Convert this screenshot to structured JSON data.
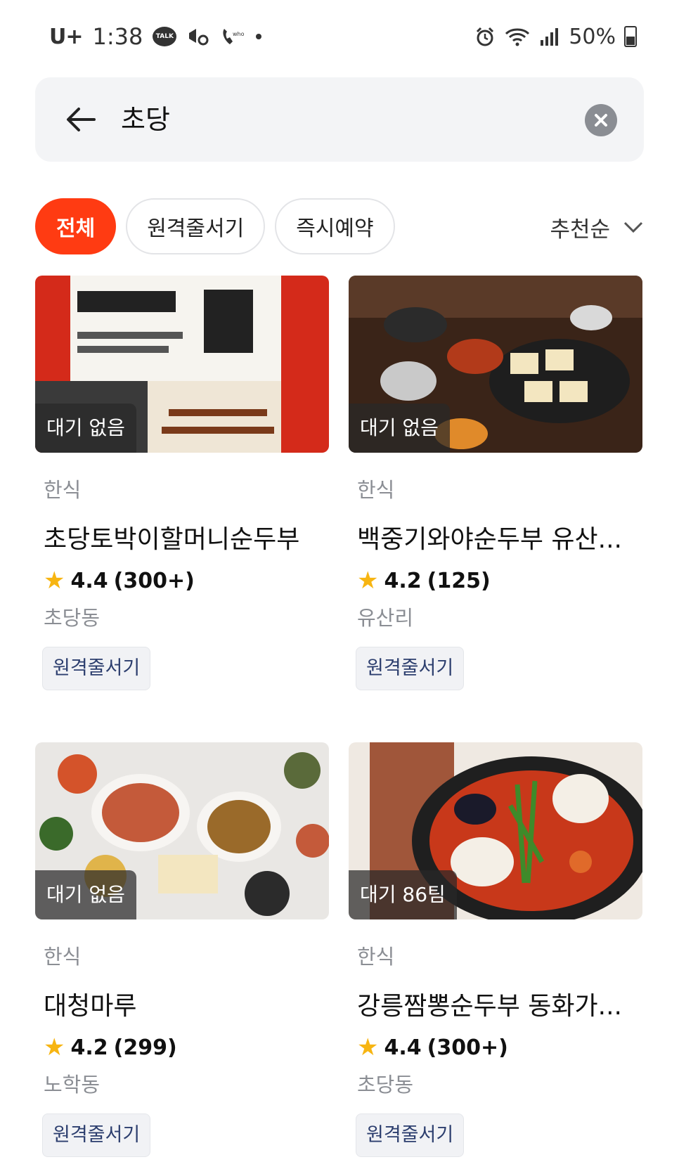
{
  "status_bar": {
    "carrier": "U+",
    "time": "1:38",
    "battery": "50%"
  },
  "search": {
    "query": "초당"
  },
  "filters": [
    "전체",
    "원격줄서기",
    "즉시예약"
  ],
  "sort_label": "추천순",
  "restaurants": [
    {
      "wait": "대기 없음",
      "category": "한식",
      "name": "초당토박이할머니순두부",
      "rating": "4.4",
      "reviews": "(300+)",
      "area": "초당동",
      "tag": "원격줄서기"
    },
    {
      "wait": "대기 없음",
      "category": "한식",
      "name": "백중기와야순두부 유산...",
      "rating": "4.2",
      "reviews": "(125)",
      "area": "유산리",
      "tag": "원격줄서기"
    },
    {
      "wait": "대기 없음",
      "category": "한식",
      "name": "대청마루",
      "rating": "4.2",
      "reviews": "(299)",
      "area": "노학동",
      "tag": "원격줄서기"
    },
    {
      "wait": "대기 86팀",
      "category": "한식",
      "name": "강릉짬뽕순두부 동화가...",
      "rating": "4.4",
      "reviews": "(300+)",
      "area": "초당동",
      "tag": "원격줄서기"
    }
  ],
  "colors": {
    "accent": "#ff3b12",
    "star": "#f7b512",
    "tag_text": "#2c3e6e"
  }
}
